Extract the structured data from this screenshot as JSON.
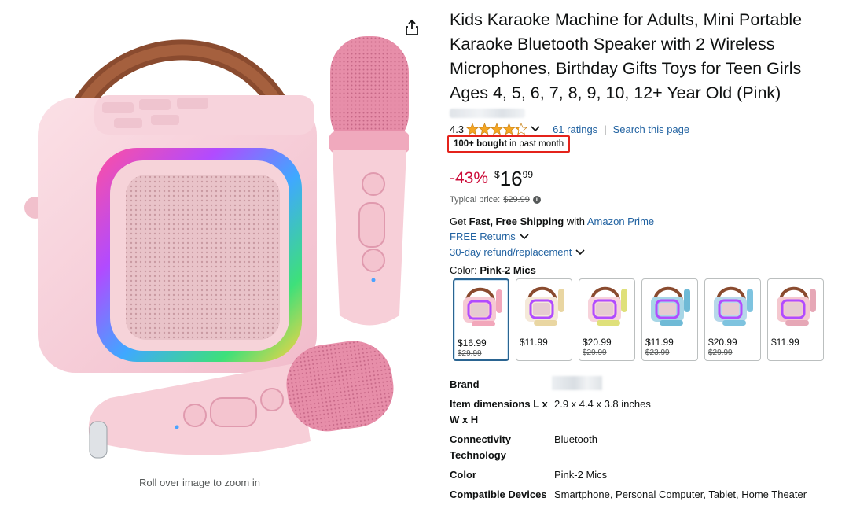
{
  "product": {
    "title": "Kids Karaoke Machine for Adults, Mini Portable Karaoke Bluetooth Speaker with 2 Wireless Microphones, Birthday Gifts Toys for Teen Girls Ages 4, 5, 6, 7, 8, 9, 10, 12+ Year Old (Pink)",
    "zoom_caption": "Roll over image to zoom in",
    "rating_value": "4.3",
    "rating_stars": 4.3,
    "ratings_count": "61 ratings",
    "rating_separator": "|",
    "search_page": "Search this page",
    "bought_bold": "100+ bought",
    "bought_rest": "in past month"
  },
  "price": {
    "discount": "-43%",
    "currency": "$",
    "whole": "16",
    "fraction": "99",
    "typical_label": "Typical price:",
    "typical_value": "$29.99",
    "info_icon": "i"
  },
  "shipping": {
    "prefix": "Get",
    "bold": "Fast, Free Shipping",
    "middle": "with",
    "prime": "Amazon Prime",
    "free_returns": "FREE Returns",
    "refund": "30-day refund/replacement"
  },
  "color": {
    "label": "Color:",
    "selected": "Pink-2 Mics",
    "swatches": [
      {
        "price": "$16.99",
        "list": "$29.99",
        "body": "#f6c9d3",
        "mic": "#f2a7bb"
      },
      {
        "price": "$11.99",
        "list": "",
        "body": "#f5e9d9",
        "mic": "#e9d6a2"
      },
      {
        "price": "$20.99",
        "list": "$29.99",
        "body": "#f7d3db",
        "mic": "#dfe07a"
      },
      {
        "price": "$11.99",
        "list": "$23.99",
        "body": "#a7d6e6",
        "mic": "#6fbad6"
      },
      {
        "price": "$20.99",
        "list": "$29.99",
        "body": "#b7d8ea",
        "mic": "#7ec3df"
      },
      {
        "price": "$11.99",
        "list": "",
        "body": "#f4c8cf",
        "mic": "#e6a7b6"
      }
    ]
  },
  "specs": [
    {
      "key": "Brand",
      "value": ""
    },
    {
      "key": "Item dimensions L x W x H",
      "value": "2.9 x 4.4 x 3.8 inches"
    },
    {
      "key": "Connectivity Technology",
      "value": "Bluetooth"
    },
    {
      "key": "Color",
      "value": "Pink-2 Mics"
    },
    {
      "key": "Compatible Devices",
      "value": "Smartphone, Personal Computer, Tablet, Home Theater"
    }
  ],
  "colors": {
    "link": "#2162a1",
    "deal_red": "#cc0c39",
    "star": "#f5a623",
    "highlight_box": "#e4231b",
    "selected_swatch": "#2a6491"
  },
  "icons": [
    "share-icon",
    "star-icon",
    "chevron-down-icon",
    "info-icon"
  ]
}
